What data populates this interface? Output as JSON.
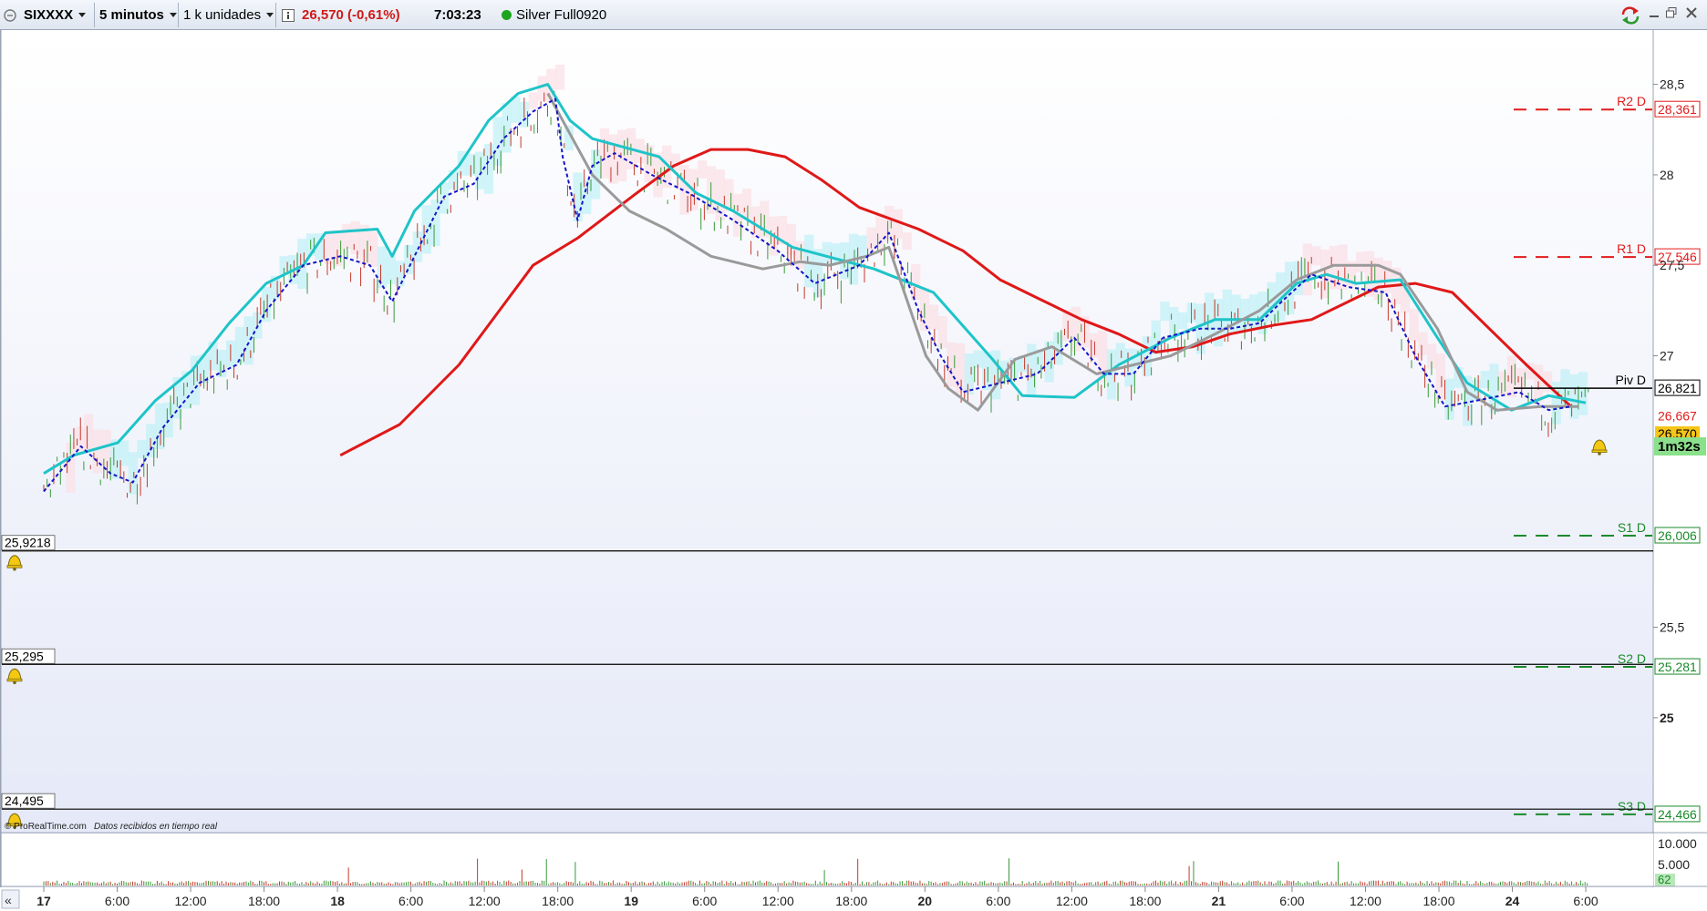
{
  "toolbar": {
    "symbol": "SIXXXX",
    "timeframe": "5 minutos",
    "units": "1 k unidades",
    "price_text": "26,570 (-0,61%)",
    "time": "7:03:23",
    "instrument": "Silver Full0920",
    "status_color": "#1ea51e"
  },
  "footer": {
    "copyright": "© ProRealTime.com",
    "realtime_note": "Datos recibidos en tiempo real"
  },
  "countdown": "1m32s",
  "chart_data": {
    "type": "line",
    "price_axis": {
      "ylim": [
        24.37,
        28.8
      ],
      "ticks": [
        {
          "label": "28,5",
          "value": 28.5
        },
        {
          "label": "28",
          "value": 28.0
        },
        {
          "label": "27,5",
          "value": 27.5
        },
        {
          "label": "27",
          "value": 27.0
        },
        {
          "label": "25,5",
          "value": 25.5
        },
        {
          "label": "25",
          "value": 25.0
        }
      ]
    },
    "time_axis": {
      "labels": [
        {
          "label": "17",
          "bold": true
        },
        {
          "label": "6:00"
        },
        {
          "label": "12:00"
        },
        {
          "label": "18:00"
        },
        {
          "label": "18",
          "bold": true
        },
        {
          "label": "6:00"
        },
        {
          "label": "12:00"
        },
        {
          "label": "18:00"
        },
        {
          "label": "19",
          "bold": true
        },
        {
          "label": "6:00"
        },
        {
          "label": "12:00"
        },
        {
          "label": "18:00"
        },
        {
          "label": "20",
          "bold": true
        },
        {
          "label": "6:00"
        },
        {
          "label": "12:00"
        },
        {
          "label": "18:00"
        },
        {
          "label": "21",
          "bold": true
        },
        {
          "label": "6:00"
        },
        {
          "label": "12:00"
        },
        {
          "label": "18:00"
        },
        {
          "label": "24",
          "bold": true
        },
        {
          "label": "6:00"
        }
      ]
    },
    "pivot_levels": [
      {
        "name": "R2 D",
        "value": 28.361,
        "label": "28,361",
        "color": "#e21b1b",
        "style": "dashed"
      },
      {
        "name": "R1 D",
        "value": 27.546,
        "label": "27,546",
        "color": "#e21b1b",
        "style": "dashed"
      },
      {
        "name": "Piv D",
        "value": 26.821,
        "label": "26,821",
        "color": "#000000",
        "style": "solid"
      },
      {
        "name": "S1 D",
        "value": 26.006,
        "label": "26,006",
        "color": "#1a8a2a",
        "style": "dashed"
      },
      {
        "name": "S2 D",
        "value": 25.281,
        "label": "25,281",
        "color": "#1a8a2a",
        "style": "dashed"
      },
      {
        "name": "S3 D",
        "value": 24.466,
        "label": "24,466",
        "color": "#1a8a2a",
        "style": "dashed"
      }
    ],
    "price_tags": [
      {
        "label": "26,667",
        "value": 26.667,
        "color": "#e21b1b",
        "fill": "#ffffff"
      },
      {
        "label": "26,570",
        "value": 26.57,
        "color": "#000000",
        "fill": "#f5c518"
      }
    ],
    "alert_lines": [
      {
        "label": "25,9218",
        "value": 25.9218
      },
      {
        "label": "25,295",
        "value": 25.295
      },
      {
        "label": "24,495",
        "value": 24.495
      }
    ],
    "series": [
      {
        "name": "",
        "color": "#e01818",
        "style": "solid",
        "points": [
          [
            4.0,
            26.45
          ],
          [
            4.8,
            26.62
          ],
          [
            5.6,
            26.95
          ],
          [
            6.2,
            27.28
          ],
          [
            6.6,
            27.5
          ],
          [
            7.2,
            27.65
          ],
          [
            8.0,
            27.9
          ],
          [
            8.5,
            28.05
          ],
          [
            9.0,
            28.14
          ],
          [
            9.5,
            28.14
          ],
          [
            10.0,
            28.1
          ],
          [
            10.5,
            27.97
          ],
          [
            11.0,
            27.82
          ],
          [
            11.8,
            27.7
          ],
          [
            12.4,
            27.58
          ],
          [
            12.9,
            27.42
          ],
          [
            13.6,
            27.28
          ],
          [
            14.0,
            27.2
          ],
          [
            14.5,
            27.12
          ],
          [
            15.0,
            27.02
          ],
          [
            15.5,
            27.05
          ],
          [
            16.0,
            27.12
          ],
          [
            16.6,
            27.17
          ],
          [
            17.1,
            27.2
          ],
          [
            17.6,
            27.3
          ],
          [
            18.0,
            27.38
          ],
          [
            18.5,
            27.4
          ],
          [
            19.0,
            27.35
          ],
          [
            19.5,
            27.15
          ],
          [
            20.0,
            26.95
          ],
          [
            20.6,
            26.72
          ]
        ]
      },
      {
        "name": "",
        "color": "#1ec4c8",
        "style": "solid",
        "points": [
          [
            0.0,
            26.35
          ],
          [
            0.4,
            26.45
          ],
          [
            1.0,
            26.52
          ],
          [
            1.5,
            26.75
          ],
          [
            2.0,
            26.92
          ],
          [
            2.5,
            27.18
          ],
          [
            3.0,
            27.4
          ],
          [
            3.5,
            27.5
          ],
          [
            3.8,
            27.68
          ],
          [
            4.5,
            27.7
          ],
          [
            4.7,
            27.55
          ],
          [
            5.0,
            27.8
          ],
          [
            5.6,
            28.05
          ],
          [
            6.0,
            28.3
          ],
          [
            6.4,
            28.45
          ],
          [
            6.8,
            28.5
          ],
          [
            7.1,
            28.3
          ],
          [
            7.4,
            28.2
          ],
          [
            8.3,
            28.1
          ],
          [
            8.8,
            27.9
          ],
          [
            9.3,
            27.8
          ],
          [
            10.1,
            27.6
          ],
          [
            11.2,
            27.48
          ],
          [
            12.0,
            27.35
          ],
          [
            12.8,
            26.98
          ],
          [
            13.2,
            26.78
          ],
          [
            13.9,
            26.77
          ],
          [
            14.5,
            26.95
          ],
          [
            15.2,
            27.1
          ],
          [
            15.8,
            27.2
          ],
          [
            16.4,
            27.2
          ],
          [
            16.9,
            27.4
          ],
          [
            17.3,
            27.45
          ],
          [
            17.7,
            27.4
          ],
          [
            18.3,
            27.42
          ],
          [
            18.8,
            27.1
          ],
          [
            19.2,
            26.85
          ],
          [
            19.8,
            26.7
          ],
          [
            20.3,
            26.78
          ],
          [
            20.8,
            26.74
          ]
        ]
      },
      {
        "name": "",
        "color": "#9a9a9a",
        "style": "solid",
        "points": [
          [
            6.8,
            28.45
          ],
          [
            7.0,
            28.3
          ],
          [
            7.4,
            28.0
          ],
          [
            7.9,
            27.8
          ],
          [
            8.4,
            27.7
          ],
          [
            9.0,
            27.55
          ],
          [
            9.7,
            27.48
          ],
          [
            10.2,
            27.52
          ],
          [
            10.6,
            27.5
          ],
          [
            11.1,
            27.55
          ],
          [
            11.4,
            27.6
          ],
          [
            11.9,
            27.0
          ],
          [
            12.2,
            26.82
          ],
          [
            12.6,
            26.7
          ],
          [
            13.1,
            26.98
          ],
          [
            13.6,
            27.05
          ],
          [
            14.2,
            26.9
          ],
          [
            14.7,
            26.95
          ],
          [
            15.2,
            27.0
          ],
          [
            15.8,
            27.12
          ],
          [
            16.4,
            27.25
          ],
          [
            16.9,
            27.42
          ],
          [
            17.4,
            27.5
          ],
          [
            18.0,
            27.5
          ],
          [
            18.3,
            27.45
          ],
          [
            18.8,
            27.15
          ],
          [
            19.2,
            26.8
          ],
          [
            19.6,
            26.7
          ],
          [
            20.2,
            26.72
          ],
          [
            20.7,
            26.72
          ]
        ]
      },
      {
        "name": "",
        "color": "#1515c8",
        "style": "dotted",
        "points": [
          [
            0.0,
            26.25
          ],
          [
            0.5,
            26.5
          ],
          [
            0.9,
            26.35
          ],
          [
            1.2,
            26.3
          ],
          [
            1.6,
            26.6
          ],
          [
            2.1,
            26.85
          ],
          [
            2.6,
            26.95
          ],
          [
            3.0,
            27.25
          ],
          [
            3.5,
            27.5
          ],
          [
            4.0,
            27.55
          ],
          [
            4.4,
            27.5
          ],
          [
            4.7,
            27.3
          ],
          [
            5.0,
            27.55
          ],
          [
            5.4,
            27.88
          ],
          [
            5.8,
            27.95
          ],
          [
            6.2,
            28.2
          ],
          [
            6.6,
            28.35
          ],
          [
            6.9,
            28.42
          ],
          [
            7.0,
            28.1
          ],
          [
            7.2,
            27.75
          ],
          [
            7.4,
            28.05
          ],
          [
            7.7,
            28.12
          ],
          [
            8.2,
            28.0
          ],
          [
            8.7,
            27.9
          ],
          [
            9.3,
            27.75
          ],
          [
            9.9,
            27.58
          ],
          [
            10.4,
            27.4
          ],
          [
            11.0,
            27.5
          ],
          [
            11.4,
            27.68
          ],
          [
            11.8,
            27.25
          ],
          [
            12.1,
            27.0
          ],
          [
            12.4,
            26.8
          ],
          [
            12.9,
            26.85
          ],
          [
            13.4,
            26.9
          ],
          [
            13.9,
            27.1
          ],
          [
            14.3,
            26.9
          ],
          [
            14.7,
            26.9
          ],
          [
            15.1,
            27.1
          ],
          [
            15.6,
            27.15
          ],
          [
            16.0,
            27.15
          ],
          [
            16.4,
            27.18
          ],
          [
            16.7,
            27.3
          ],
          [
            17.1,
            27.45
          ],
          [
            17.6,
            27.38
          ],
          [
            18.1,
            27.35
          ],
          [
            18.5,
            27.0
          ],
          [
            18.9,
            26.72
          ],
          [
            19.3,
            26.75
          ],
          [
            19.9,
            26.8
          ],
          [
            20.3,
            26.7
          ],
          [
            20.6,
            26.72
          ]
        ]
      }
    ],
    "volume": {
      "ticks": [
        {
          "label": "10.000",
          "value": 10000
        },
        {
          "label": "5.000",
          "value": 5000
        }
      ],
      "current_label": "62",
      "current_value": 62
    }
  }
}
